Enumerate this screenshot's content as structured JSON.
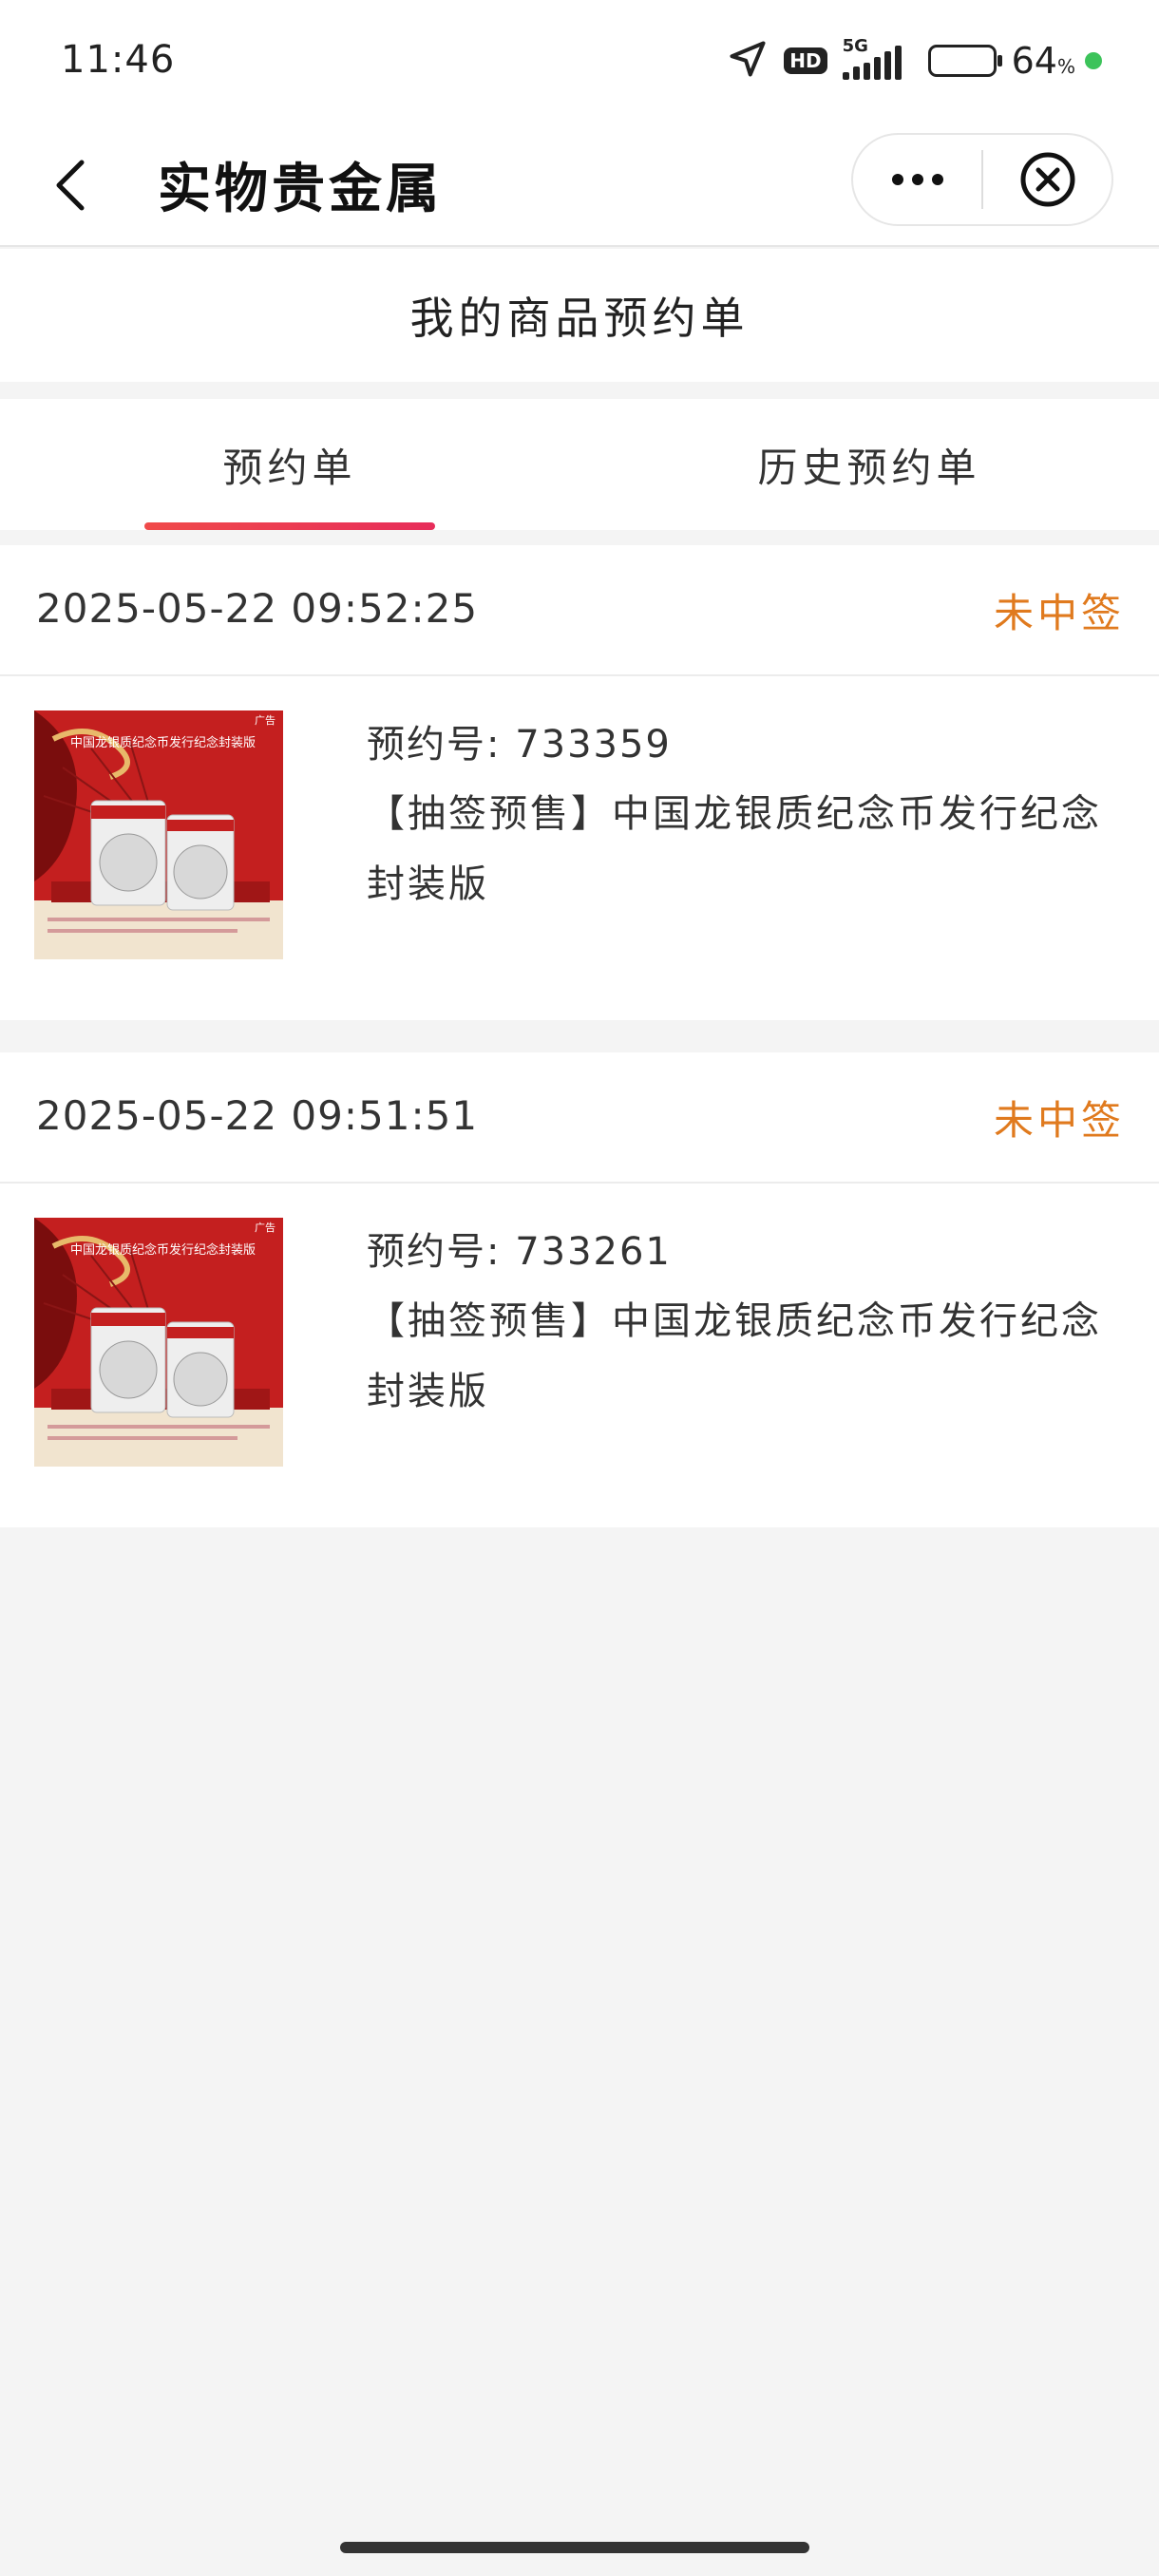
{
  "status_bar": {
    "time": "11:46",
    "network_badge": "HD",
    "network_type": "5G",
    "battery_percent": "64",
    "battery_unit": "%",
    "battery_level": 0.64,
    "icons": [
      "location-arrow-icon",
      "hd-icon",
      "signal-5g-icon",
      "battery-icon",
      "privacy-dot-icon"
    ]
  },
  "nav": {
    "title": "实物贵金属",
    "back_icon": "chevron-left-icon",
    "more_icon": "more-dots-icon",
    "close_icon": "close-circle-icon"
  },
  "page": {
    "header": "我的商品预约单"
  },
  "tabs": [
    {
      "label": "预约单",
      "active": true
    },
    {
      "label": "历史预约单",
      "active": false
    }
  ],
  "orders": [
    {
      "timestamp": "2025-05-22 09:52:25",
      "status": "未中签",
      "reservation_no": "预约号: 733359",
      "product_name": "【抽签预售】中国龙银质纪念币发行纪念封装版",
      "image": {
        "title": "中国龙银质纪念币发行纪念封装版",
        "ad_tag": "广告"
      }
    },
    {
      "timestamp": "2025-05-22 09:51:51",
      "status": "未中签",
      "reservation_no": "预约号: 733261",
      "product_name": "【抽签预售】中国龙银质纪念币发行纪念封装版",
      "image": {
        "title": "中国龙银质纪念币发行纪念封装版",
        "ad_tag": "广告"
      }
    }
  ],
  "colors": {
    "accent_orange": "#e07a1e",
    "tab_indicator": "#e8385a",
    "background": "#f4f4f4"
  }
}
